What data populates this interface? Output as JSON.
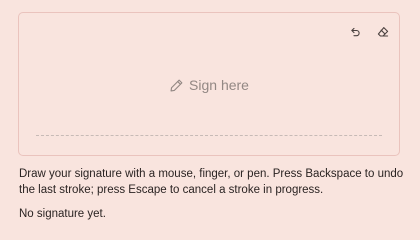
{
  "signature_pad": {
    "placeholder": "Sign here",
    "undo_icon": "undo-icon",
    "clear_icon": "eraser-icon",
    "placeholder_icon": "pen-icon"
  },
  "help_text": "Draw your signature with a mouse, finger, or pen. Press Backspace to undo the last stroke; press Escape to cancel a stroke in progress.",
  "status_text": "No signature yet.",
  "colors": {
    "background": "#f9e4de",
    "border": "#eac3bd",
    "placeholder": "#938884",
    "text": "#2a2322"
  }
}
